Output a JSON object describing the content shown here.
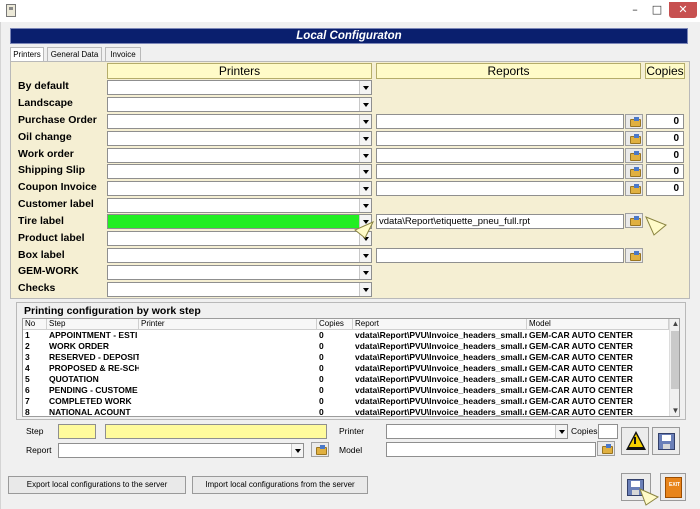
{
  "window": {
    "title": "Local Configuraton",
    "min": "–",
    "max": "□",
    "close": "✕"
  },
  "tabs": [
    "Printers",
    "General Data",
    "Invoice"
  ],
  "columns": {
    "printers": "Printers",
    "reports": "Reports",
    "copies": "Copies"
  },
  "rows": [
    {
      "label": "By default"
    },
    {
      "label": "Landscape"
    },
    {
      "label": "Purchase Order",
      "copies": "0"
    },
    {
      "label": "Oil change",
      "copies": "0"
    },
    {
      "label": "Work order",
      "copies": "0"
    },
    {
      "label": "Shipping Slip",
      "copies": "0"
    },
    {
      "label": "Coupon Invoice",
      "copies": "0"
    },
    {
      "label": "Customer label"
    },
    {
      "label": "Tire label",
      "report": "vdata\\Report\\etiquette_pneu_full.rpt"
    },
    {
      "label": "Product label"
    },
    {
      "label": "Box label"
    },
    {
      "label": "GEM-WORK"
    },
    {
      "label": "Checks"
    }
  ],
  "work_steps": {
    "title": "Printing configuration by work step",
    "headers": [
      "No",
      "Step",
      "Printer",
      "Copies",
      "Report",
      "Model"
    ],
    "rows": [
      {
        "no": "1",
        "step": "APPOINTMENT - ESTI",
        "printer": "",
        "copies": "0",
        "report": "vdata\\Report\\PVU\\Invoice_headers_small.r",
        "model": "GEM-CAR AUTO CENTER"
      },
      {
        "no": "2",
        "step": "WORK ORDER",
        "printer": "",
        "copies": "0",
        "report": "vdata\\Report\\PVU\\Invoice_headers_small.r",
        "model": "GEM-CAR AUTO CENTER"
      },
      {
        "no": "3",
        "step": "RESERVED - DEPOSIT",
        "printer": "",
        "copies": "0",
        "report": "vdata\\Report\\PVU\\Invoice_headers_small.r",
        "model": "GEM-CAR AUTO CENTER"
      },
      {
        "no": "4",
        "step": "PROPOSED & RE-SCH",
        "printer": "",
        "copies": "0",
        "report": "vdata\\Report\\PVU\\Invoice_headers_small.r",
        "model": "GEM-CAR AUTO CENTER"
      },
      {
        "no": "5",
        "step": "QUOTATION",
        "printer": "",
        "copies": "0",
        "report": "vdata\\Report\\PVU\\Invoice_headers_small.r",
        "model": "GEM-CAR AUTO CENTER"
      },
      {
        "no": "6",
        "step": "PENDING - CUSTOME",
        "printer": "",
        "copies": "0",
        "report": "vdata\\Report\\PVU\\Invoice_headers_small.r",
        "model": "GEM-CAR AUTO CENTER"
      },
      {
        "no": "7",
        "step": "COMPLETED WORK",
        "printer": "",
        "copies": "0",
        "report": "vdata\\Report\\PVU\\Invoice_headers_small.r",
        "model": "GEM-CAR AUTO CENTER"
      },
      {
        "no": "8",
        "step": "NATIONAL ACOUNT",
        "printer": "",
        "copies": "0",
        "report": "vdata\\Report\\PVU\\Invoice_headers_small.r",
        "model": "GEM-CAR AUTO CENTER"
      }
    ]
  },
  "editor": {
    "step_label": "Step",
    "report_label": "Report",
    "printer_label": "Printer",
    "model_label": "Model",
    "copies_label": "Copies"
  },
  "footer": {
    "export_label": "Export local configurations to the server",
    "import_label": "Import local configurations from the server",
    "exit_label": "EXIT"
  },
  "colors": {
    "banner": "#0a1f6e",
    "panel": "#f5efd3",
    "highlight_green": "#22ee22",
    "header_yellow": "#fffbc8"
  },
  "icons": [
    "app-icon",
    "browse-folder-icon",
    "warning-icon",
    "save-disk-icon",
    "exit-door-icon",
    "pointer-arrow-icon"
  ]
}
